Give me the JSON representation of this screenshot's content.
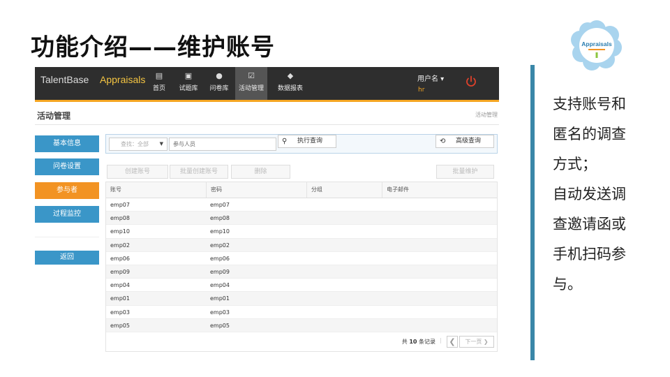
{
  "slide": {
    "title": "功能介绍——维护账号",
    "description_lines": [
      "支持账号和",
      "匿名的调查",
      "方式；",
      "自动发送调",
      "查邀请函或",
      "手机扫码参",
      "与。"
    ],
    "logo_text": "Appraisals",
    "accent_color": "#3a87a8"
  },
  "app": {
    "brand": "TalentBase",
    "product": "Appraisals",
    "nav": [
      {
        "label": "首页",
        "icon": "building-icon"
      },
      {
        "label": "试题库",
        "icon": "inbox-icon"
      },
      {
        "label": "问卷库",
        "icon": "user-icon"
      },
      {
        "label": "活动管理",
        "icon": "clipboard-icon",
        "active": true
      },
      {
        "label": "数据报表",
        "icon": "box-icon"
      }
    ],
    "user_label": "用户名 ▾",
    "user_name": "hr",
    "page_title": "活动管理",
    "breadcrumb": "活动管理",
    "sidebar": [
      "基本信息",
      "问卷设置",
      "参与者",
      "过程监控",
      "返回"
    ],
    "sidebar_active": "参与者",
    "search": {
      "select_value": "查找：全部",
      "input_placeholder": "参与人员",
      "search_button": "执行查询",
      "advanced_button": "高级查询"
    },
    "toolbar": {
      "create": "创建账号",
      "batch_create": "批量创建账号",
      "delete": "删除",
      "batch_maintain": "批量维护"
    },
    "table": {
      "columns": [
        "账号",
        "密码",
        "分组",
        "电子邮件"
      ],
      "rows": [
        [
          "emp07",
          "emp07",
          "",
          ""
        ],
        [
          "emp08",
          "emp08",
          "",
          ""
        ],
        [
          "emp10",
          "emp10",
          "",
          ""
        ],
        [
          "emp02",
          "emp02",
          "",
          ""
        ],
        [
          "emp06",
          "emp06",
          "",
          ""
        ],
        [
          "emp09",
          "emp09",
          "",
          ""
        ],
        [
          "emp04",
          "emp04",
          "",
          ""
        ],
        [
          "emp01",
          "emp01",
          "",
          ""
        ],
        [
          "emp03",
          "emp03",
          "",
          ""
        ],
        [
          "emp05",
          "emp05",
          "",
          ""
        ]
      ]
    },
    "pager": {
      "total_prefix": "共",
      "total_count": "10",
      "total_suffix": "条记录",
      "next_label": "下一页"
    },
    "colors": {
      "topbar": "#2e2e2e",
      "accent": "#f5a623",
      "sidebar": "#3a96c8",
      "sidebar_active": "#f29323"
    }
  }
}
